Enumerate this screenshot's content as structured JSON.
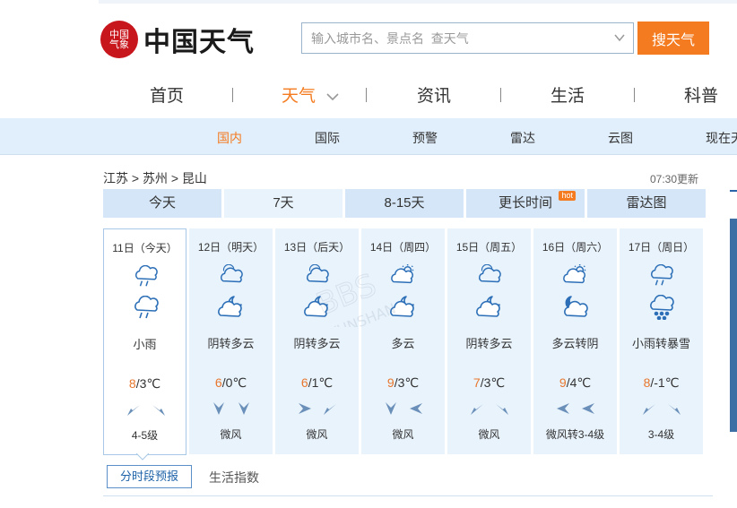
{
  "header": {
    "logo": {
      "seal_text": "中国气象",
      "title": "中国天气"
    },
    "search": {
      "placeholder": "输入城市名、景点名  查天气",
      "button_label": "搜天气"
    },
    "main_nav": [
      "首页",
      "天气",
      "资讯",
      "生活",
      "科普"
    ],
    "sub_nav": [
      "国内",
      "国际",
      "预警",
      "雷达",
      "云图",
      "现在天"
    ]
  },
  "breadcrumb": "江苏 > 苏州 > 昆山",
  "update_time": "07:30更新",
  "tabs": {
    "items": [
      "今天",
      "7天",
      "8-15天",
      "更长时间",
      "雷达图"
    ],
    "hot_badge": "hot"
  },
  "forecast": [
    {
      "date": "11日（今天）",
      "day_icon": "light-rain-icon",
      "night_icon": "light-rain-icon",
      "condition": "小雨",
      "high": "8",
      "low": "3℃",
      "wind_level": "4-5级"
    },
    {
      "date": "12日（明天）",
      "day_icon": "cloudy-icon",
      "night_icon": "partly-cloudy-night-icon",
      "condition": "阴转多云",
      "high": "6",
      "low": "0℃",
      "wind_level": "微风"
    },
    {
      "date": "13日（后天）",
      "day_icon": "cloudy-icon",
      "night_icon": "partly-cloudy-night-icon",
      "condition": "阴转多云",
      "high": "6",
      "low": "1℃",
      "wind_level": "微风"
    },
    {
      "date": "14日（周四）",
      "day_icon": "partly-cloudy-day-icon",
      "night_icon": "partly-cloudy-night-icon",
      "condition": "多云",
      "high": "9",
      "low": "3℃",
      "wind_level": "微风"
    },
    {
      "date": "15日（周五）",
      "day_icon": "cloudy-icon",
      "night_icon": "partly-cloudy-night-icon",
      "condition": "阴转多云",
      "high": "7",
      "low": "3℃",
      "wind_level": "微风"
    },
    {
      "date": "16日（周六）",
      "day_icon": "partly-cloudy-day-icon",
      "night_icon": "overcast-night-icon",
      "condition": "多云转阴",
      "high": "9",
      "low": "4℃",
      "wind_level": "微风转3-4级"
    },
    {
      "date": "17日（周日）",
      "day_icon": "light-rain-icon",
      "night_icon": "blizzard-icon",
      "condition": "小雨转暴雪",
      "high": "8",
      "low": "-1℃",
      "wind_level": "3-4级"
    }
  ],
  "bottom_tabs": [
    "分时段预报",
    "生活指数"
  ],
  "colors": {
    "accent": "#f47b20",
    "icon_blue": "#2c6fb7",
    "tab_bg": "#d4e6f7",
    "card_bg": "#e9f3fc"
  }
}
